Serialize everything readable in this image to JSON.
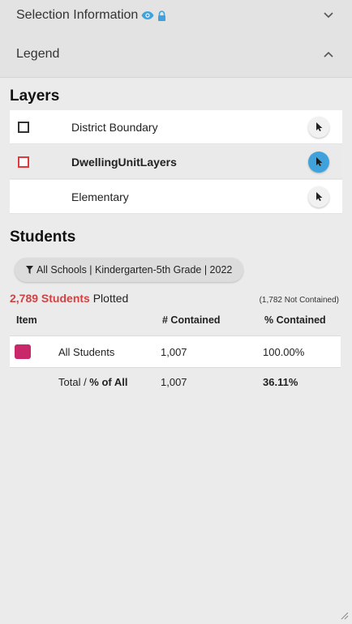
{
  "selection": {
    "title": "Selection Information"
  },
  "legend": {
    "title": "Legend"
  },
  "layers": {
    "title": "Layers",
    "items": [
      {
        "name": "District Boundary"
      },
      {
        "name": "DwellingUnitLayers"
      },
      {
        "name": "Elementary"
      }
    ]
  },
  "students": {
    "title": "Students",
    "filter": "All Schools | Kindergarten-5th Grade | 2022",
    "plotted_count": "2,789 Students",
    "plotted_label": "Plotted",
    "not_contained": "(1,782 Not Contained)",
    "table": {
      "headers": {
        "item": "Item",
        "contained": "# Contained",
        "pct": "% Contained"
      },
      "row": {
        "label": "All Students",
        "contained": "1,007",
        "pct": "100.00%"
      },
      "total": {
        "label": "Total / ",
        "label_bold": "% of All",
        "contained": "1,007",
        "pct": "36.11%"
      }
    }
  },
  "colors": {
    "accent_blue": "#3fa2dc",
    "student_swatch": "#c8286a",
    "plotted_red": "#d24242",
    "layer_square_red": "#e03a3a"
  }
}
